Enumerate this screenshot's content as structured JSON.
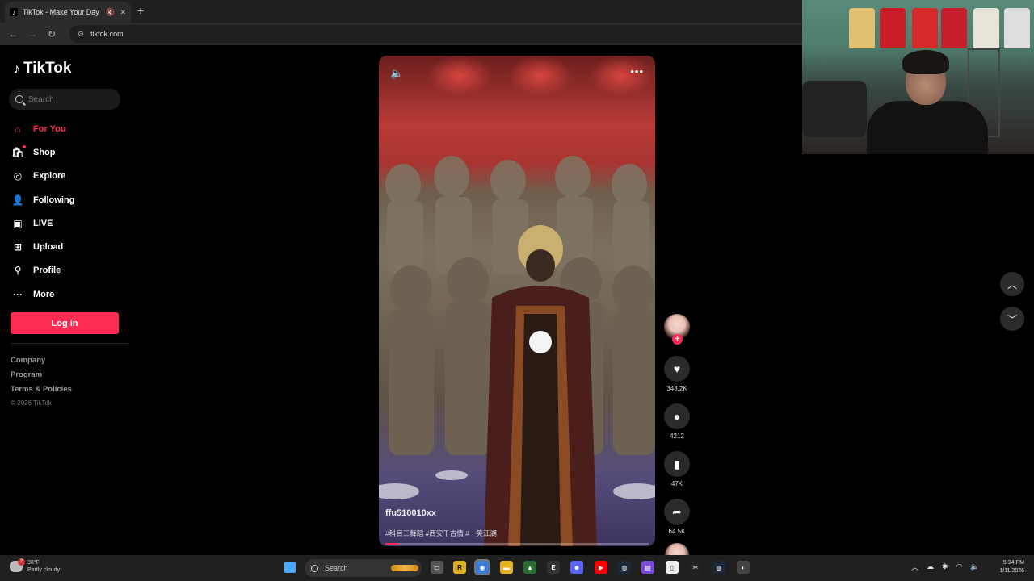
{
  "browser": {
    "tab_title": "TikTok - Make Your Day",
    "tab_favicon": "tiktok-icon",
    "new_tab": "+",
    "url": "tiktok.com"
  },
  "sidebar": {
    "logo": "TikTok",
    "search_placeholder": "Search",
    "items": [
      {
        "label": "For You",
        "icon": "home-icon",
        "active": true
      },
      {
        "label": "Shop",
        "icon": "shopping-bag-icon"
      },
      {
        "label": "Explore",
        "icon": "compass-icon"
      },
      {
        "label": "Following",
        "icon": "following-icon"
      },
      {
        "label": "LIVE",
        "icon": "live-tv-icon"
      },
      {
        "label": "Upload",
        "icon": "upload-icon"
      },
      {
        "label": "Profile",
        "icon": "person-icon"
      },
      {
        "label": "More",
        "icon": "more-dots-icon"
      }
    ],
    "login_label": "Log in",
    "footer": [
      "Company",
      "Program",
      "Terms & Policies"
    ],
    "copyright": "© 2026 TikTok"
  },
  "video": {
    "author": "ffu510010xx",
    "hashtags": "#科目三舞蹈 #西安千古情 #一笑江湖",
    "progress": 0.05
  },
  "actions": {
    "likes": "348.2K",
    "comments": "4212",
    "saves": "47K",
    "shares": "64.5K"
  },
  "taskbar": {
    "temp": "38°F",
    "weather": "Partly cloudy",
    "weather_badge": "2",
    "search_label": "Search",
    "time": "5:34 PM",
    "date": "1/11/2026"
  },
  "colors": {
    "accent": "#fe2c55",
    "background": "#000000"
  }
}
